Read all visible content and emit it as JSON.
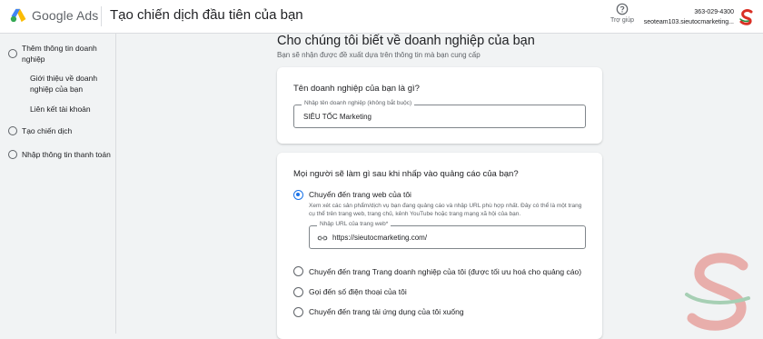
{
  "header": {
    "brand": "Google Ads",
    "title": "Tạo chiến dịch đầu tiên của bạn",
    "help_label": "Trợ giúp",
    "account_id": "363-029-4300",
    "account_email": "seoteam103.sieutocmarketing..."
  },
  "sidebar": {
    "step1": "Thêm thông tin doanh nghiệp",
    "step1_sub1": "Giới thiệu về doanh nghiệp của bạn",
    "step1_sub2": "Liên kết tài khoản",
    "step2": "Tạo chiến dịch",
    "step3": "Nhập thông tin thanh toán"
  },
  "main": {
    "heading": "Cho chúng tôi biết về doanh nghiệp của bạn",
    "subheading": "Bạn sẽ nhận được đề xuất dựa trên thông tin mà bạn cung cấp",
    "business_card": {
      "question": "Tên doanh nghiệp của bạn là gì?",
      "field_label": "Nhập tên doanh nghiệp (không bắt buộc)",
      "field_value": "SIÊU TỐC Marketing"
    },
    "action_card": {
      "question": "Mọi người sẽ làm gì sau khi nhấp vào quảng cáo của bạn?",
      "options": [
        {
          "label": "Chuyển đến trang web của tôi",
          "selected": true,
          "description": "Xem xét các sản phẩm/dịch vụ bạn đang quảng cáo và nhập URL phù hợp nhất. Đây có thể là một trang cụ thể trên trang web, trang chủ, kênh YouTube hoặc trang mạng xã hội của bạn."
        },
        {
          "label": "Chuyển đến trang Trang doanh nghiệp của tôi (được tối ưu hoá cho quảng cáo)",
          "selected": false
        },
        {
          "label": "Gọi đến số điện thoại của tôi",
          "selected": false
        },
        {
          "label": "Chuyển đến trang tải ứng dụng của tôi xuống",
          "selected": false
        }
      ],
      "url_field_label": "Nhập URL của trang web*",
      "url_value": "https://sieutocmarketing.com/"
    }
  },
  "colors": {
    "accent": "#1a73e8",
    "background": "#f1f3f4",
    "card": "#ffffff",
    "watermark_red": "#d93025",
    "watermark_green": "#1e8e3e"
  },
  "icons": [
    "google-ads-logo",
    "help-icon",
    "avatar-s-icon",
    "link-icon",
    "watermark-s-logo"
  ]
}
